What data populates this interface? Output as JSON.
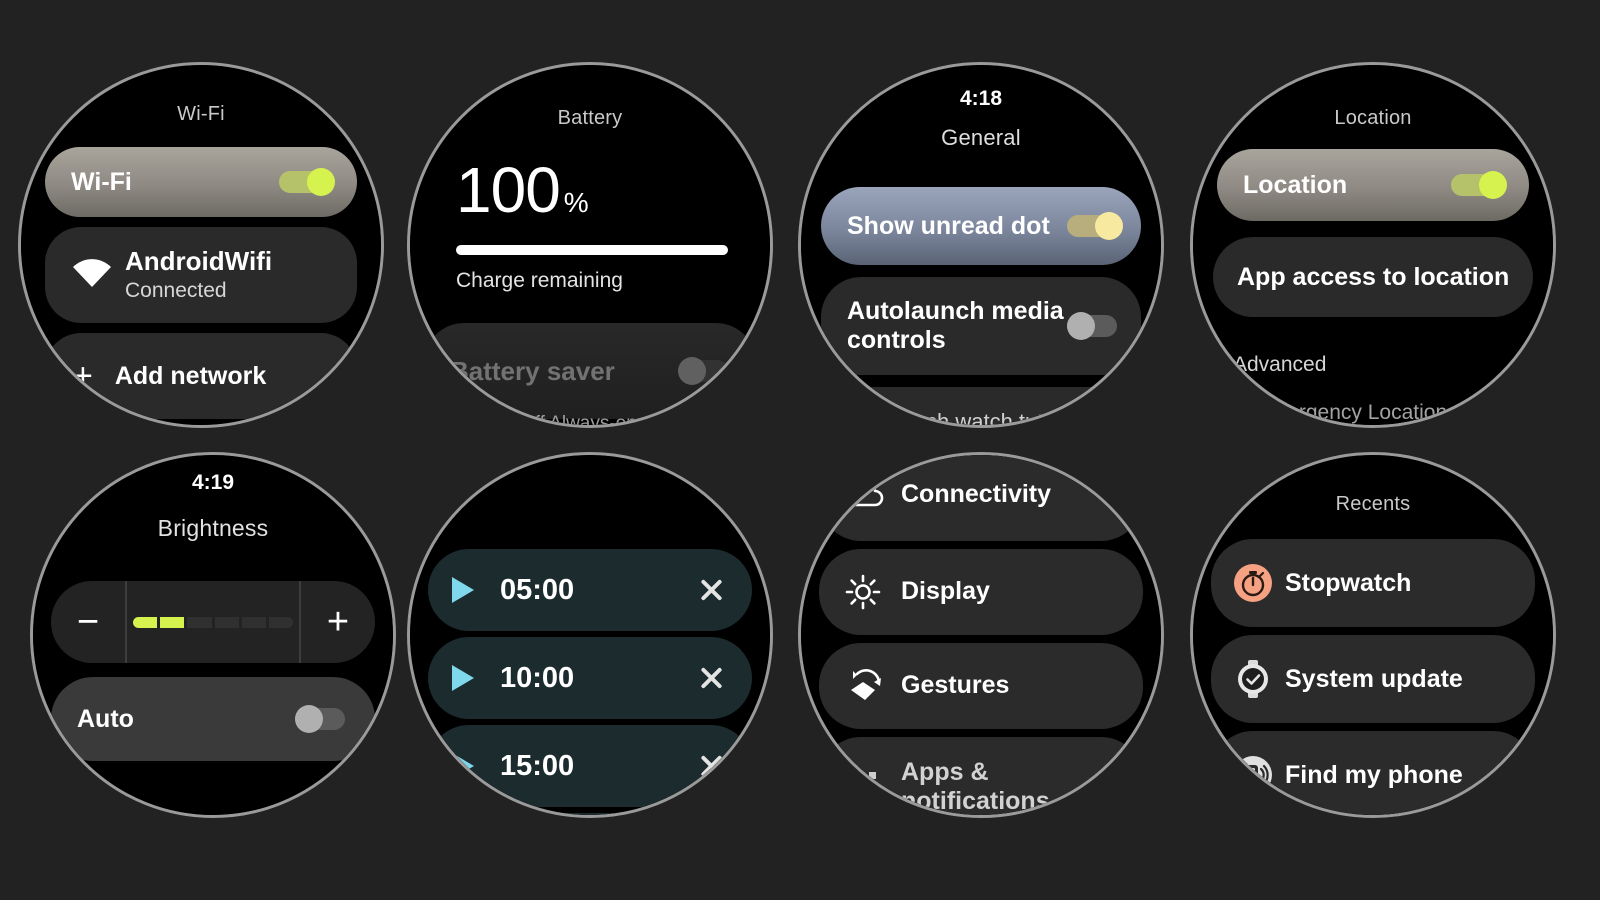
{
  "theme": {
    "page_background": "#222222",
    "bezel": "#9a9a9a",
    "screen": "#000000",
    "accent_green": "#d6f24f",
    "accent_yellow": "#f7e9a0",
    "accent_cyan": "#7fd8ec",
    "accent_salmon": "#f7a183",
    "card": "#2b2b2b",
    "timer_card": "#1b2b2e"
  },
  "watches": {
    "wifi": {
      "title": "Wi-Fi",
      "toggle_row": {
        "label": "Wi-Fi",
        "toggle_state": "on"
      },
      "network": {
        "icon": "wifi-icon",
        "name": "AndroidWifi",
        "status": "Connected"
      },
      "add_network": {
        "icon": "plus-icon",
        "label": "Add network"
      }
    },
    "battery": {
      "title": "Battery",
      "percent": "100",
      "percent_sign": "%",
      "progress": 100,
      "caption": "Charge remaining",
      "saver": {
        "label": "Battery saver",
        "toggle_state": "off"
      },
      "note": "ns off Always-on Scre"
    },
    "general": {
      "clock": "4:18",
      "title": "General",
      "rows": [
        {
          "label": "Show unread dot",
          "toggle_state": "on-yellow",
          "highlighted": true
        },
        {
          "label": "Autolaunch media controls",
          "toggle_state": "off",
          "highlighted": false
        }
      ],
      "partial_row": "Launch watch tutorial"
    },
    "location": {
      "title": "Location",
      "toggle_row": {
        "label": "Location",
        "toggle_state": "on"
      },
      "app_access": {
        "label": "App access to location"
      },
      "advanced": "Advanced",
      "note": "rgency Location"
    },
    "brightness": {
      "clock": "4:19",
      "title": "Brightness",
      "minus_label": "−",
      "plus_label": "+",
      "slider": {
        "segments": 6,
        "filled": 2,
        "value_percent": 33
      },
      "auto": {
        "label": "Auto",
        "toggle_state": "off"
      }
    },
    "timers": {
      "items": [
        {
          "time": "05:00",
          "play_icon": "play-icon",
          "dismiss_icon": "close-icon"
        },
        {
          "time": "10:00",
          "play_icon": "play-icon",
          "dismiss_icon": "close-icon"
        },
        {
          "time": "15:00",
          "play_icon": "play-icon",
          "dismiss_icon": "close-icon"
        }
      ]
    },
    "settings_list": {
      "items": [
        {
          "label": "Connectivity",
          "icon": "cloud-icon"
        },
        {
          "label": "Display",
          "icon": "sun-icon"
        },
        {
          "label": "Gestures",
          "icon": "gesture-hand-icon"
        },
        {
          "label": "Apps & notifications",
          "icon": "apps-grid-icon"
        }
      ]
    },
    "recents": {
      "title": "Recents",
      "items": [
        {
          "label": "Stopwatch",
          "icon": "stopwatch-icon",
          "icon_color": "#f7a183"
        },
        {
          "label": "System update",
          "icon": "watch-check-icon",
          "icon_color": "#e6e6e6"
        },
        {
          "label": "Find my phone",
          "icon": "find-phone-icon",
          "icon_color": "#e6e6e6"
        }
      ]
    }
  }
}
